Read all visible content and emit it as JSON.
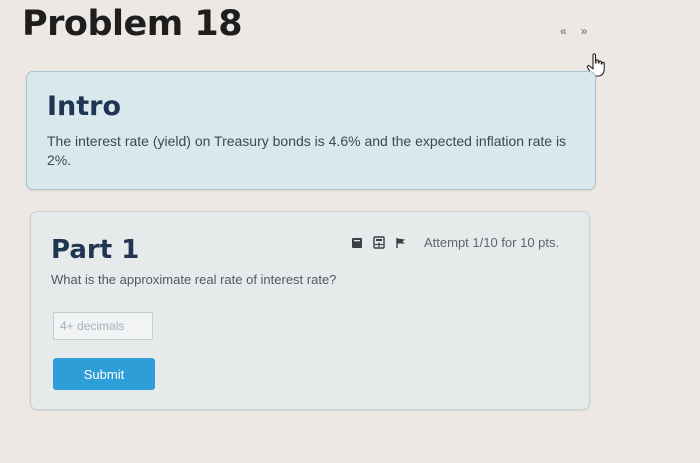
{
  "page": {
    "title": "Problem 18"
  },
  "nav": {
    "prev_label": "«",
    "next_label": "»"
  },
  "intro": {
    "heading": "Intro",
    "text": "The interest rate (yield) on Treasury bonds is 4.6% and the expected inflation rate is 2%."
  },
  "part": {
    "heading": "Part 1",
    "attempt_text": "Attempt 1/10 for 10 pts.",
    "question": "What is the approximate real rate of interest rate?",
    "input_placeholder": "4+ decimals",
    "input_value": "",
    "submit_label": "Submit",
    "icons": [
      "answer-icon",
      "calculator-icon",
      "flag-icon"
    ]
  },
  "colors": {
    "intro_bg": "#d9e8ec",
    "heading_navy": "#1f3551",
    "submit_blue": "#2e9ed8"
  }
}
